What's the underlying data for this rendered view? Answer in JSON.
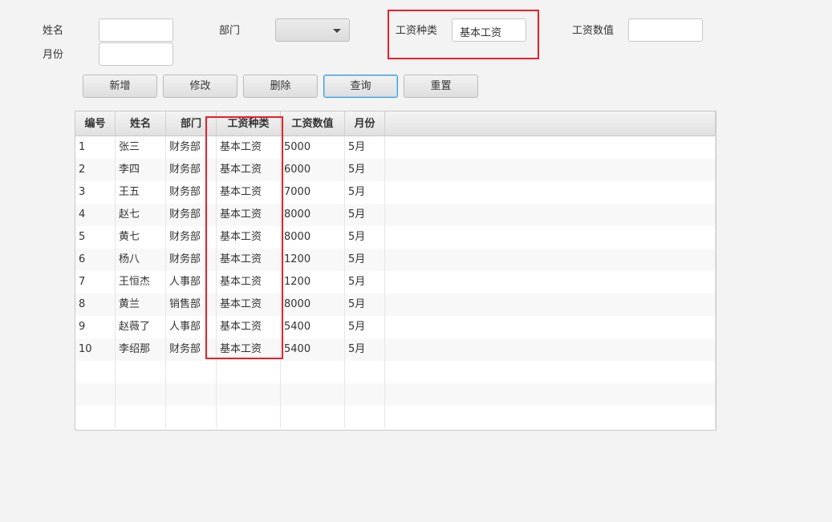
{
  "form": {
    "name_label": "姓名",
    "name_value": "",
    "month_label": "月份",
    "month_value": "",
    "dept_label": "部门",
    "dept_value": "",
    "salary_type_label": "工资种类",
    "salary_type_value": "基本工资",
    "salary_value_label": "工资数值",
    "salary_value_value": ""
  },
  "buttons": {
    "add": "新增",
    "edit": "修改",
    "delete": "删除",
    "query": "查询",
    "reset": "重置"
  },
  "table": {
    "headers": [
      "编号",
      "姓名",
      "部门",
      "工资种类",
      "工资数值",
      "月份"
    ],
    "rows": [
      [
        "1",
        "张三",
        "财务部",
        "基本工资",
        "5000",
        "5月"
      ],
      [
        "2",
        "李四",
        "财务部",
        "基本工资",
        "6000",
        "5月"
      ],
      [
        "3",
        "王五",
        "财务部",
        "基本工资",
        "7000",
        "5月"
      ],
      [
        "4",
        "赵七",
        "财务部",
        "基本工资",
        "8000",
        "5月"
      ],
      [
        "5",
        "黄七",
        "财务部",
        "基本工资",
        "8000",
        "5月"
      ],
      [
        "6",
        "杨八",
        "财务部",
        "基本工资",
        "1200",
        "5月"
      ],
      [
        "7",
        "王恒杰",
        "人事部",
        "基本工资",
        "1200",
        "5月"
      ],
      [
        "8",
        "黄兰",
        "销售部",
        "基本工资",
        "8000",
        "5月"
      ],
      [
        "9",
        "赵薇了",
        "人事部",
        "基本工资",
        "5400",
        "5月"
      ],
      [
        "10",
        "李绍那",
        "财务部",
        "基本工资",
        "5400",
        "5月"
      ]
    ]
  },
  "highlight_color": "#e8202a"
}
